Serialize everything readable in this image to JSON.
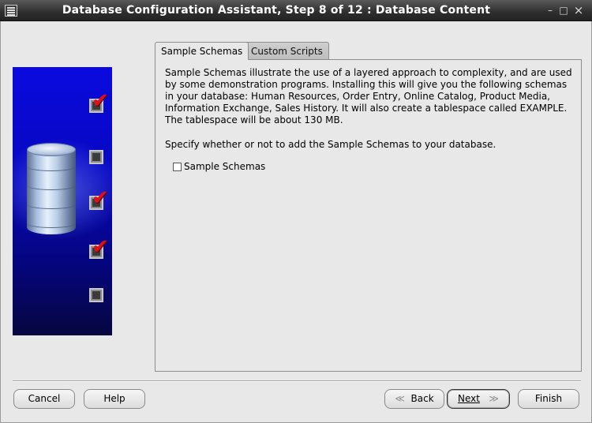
{
  "window": {
    "title": "Database Configuration Assistant, Step 8 of 12 : Database Content",
    "minimize_glyph": "–",
    "maximize_glyph": "□",
    "close_glyph": "×"
  },
  "tabs": [
    {
      "label": "Sample Schemas",
      "active": true
    },
    {
      "label": "Custom Scripts",
      "active": false
    }
  ],
  "sample_schemas": {
    "description": "Sample Schemas illustrate the use of a layered approach to complexity, and are used by some demonstration programs. Installing this will give you the following schemas in your database: Human Resources, Order Entry, Online Catalog, Product Media, Information Exchange, Sales History. It will also create a tablespace called EXAMPLE. The tablespace will be about 130 MB.",
    "specify_text": "Specify whether or not to add the Sample Schemas to your database.",
    "checkbox_label": "Sample Schemas",
    "checkbox_checked": false
  },
  "steps": [
    {
      "checked": true
    },
    {
      "checked": false
    },
    {
      "checked": true
    },
    {
      "checked": true
    },
    {
      "checked": false
    }
  ],
  "buttons": {
    "cancel": "Cancel",
    "help": "Help",
    "back": "Back",
    "next": "Next",
    "finish": "Finish",
    "back_arrow": "≪",
    "next_arrow": "≫"
  },
  "colors": {
    "panel_blue": "#0707c0",
    "check_red": "#e0101a"
  }
}
